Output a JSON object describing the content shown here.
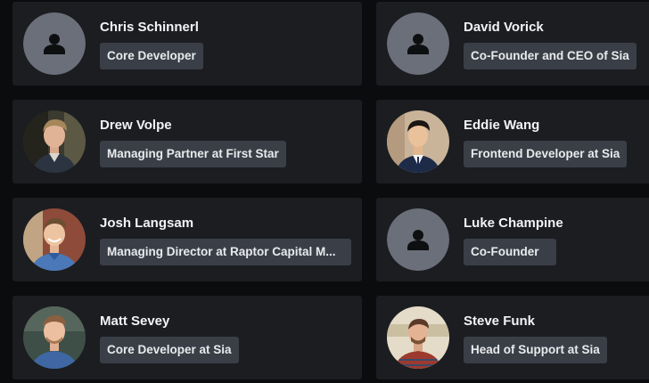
{
  "team": [
    {
      "name": "Chris Schinnerl",
      "role": "Core Developer",
      "avatar": "default-avatar-icon"
    },
    {
      "name": "David Vorick",
      "role": "Co-Founder and CEO of Sia",
      "avatar": "default-avatar-icon"
    },
    {
      "name": "Drew Volpe",
      "role": "Managing Partner at First Star",
      "avatar": "photo"
    },
    {
      "name": "Eddie Wang",
      "role": "Frontend Developer at Sia",
      "avatar": "photo"
    },
    {
      "name": "Josh Langsam",
      "role": "Managing Director at Raptor Capital M...",
      "avatar": "photo"
    },
    {
      "name": "Luke Champine",
      "role": "Co-Founder",
      "avatar": "default-avatar-icon"
    },
    {
      "name": "Matt Sevey",
      "role": "Core Developer at Sia",
      "avatar": "photo"
    },
    {
      "name": "Steve Funk",
      "role": "Head of Support at Sia",
      "avatar": "photo"
    }
  ],
  "colors": {
    "page_background": "#0b0c0e",
    "card_background": "#1b1d21",
    "role_badge_background": "#3a3f47",
    "default_avatar_background": "#6b6f79"
  }
}
